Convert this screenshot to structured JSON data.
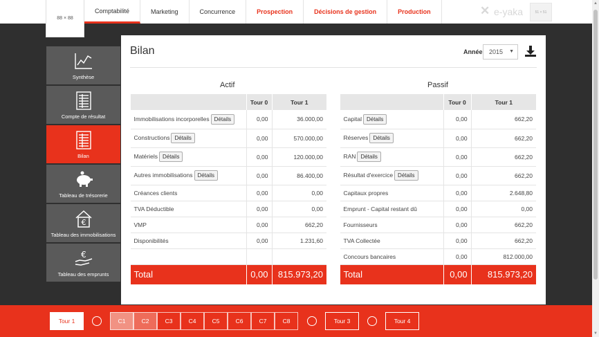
{
  "header": {
    "logo_text": "88 × 88",
    "avatar_text": "51 × 51",
    "brand": "e-yaka",
    "tabs": [
      {
        "label": "Comptabilité"
      },
      {
        "label": "Marketing"
      },
      {
        "label": "Concurrence"
      },
      {
        "label": "Prospection"
      },
      {
        "label": "Décisions de gestion"
      },
      {
        "label": "Production"
      }
    ]
  },
  "sidebar": {
    "items": [
      {
        "label": "Synthèse",
        "icon": "chart-icon"
      },
      {
        "label": "Compte de résultat",
        "icon": "ledger-icon"
      },
      {
        "label": "Bilan",
        "icon": "ledger-icon"
      },
      {
        "label": "Tableau de trésorerie",
        "icon": "piggy-bank-icon"
      },
      {
        "label": "Tableau des immobilisations",
        "icon": "house-euro-icon"
      },
      {
        "label": "Tableau des emprunts",
        "icon": "hand-euro-icon"
      }
    ]
  },
  "main": {
    "title": "Bilan",
    "year_label": "Année",
    "year_value": "2015",
    "details_label": "Détails",
    "actif": {
      "title": "Actif",
      "headers": [
        "",
        "Tour 0",
        "Tour 1"
      ],
      "rows": [
        {
          "label": "Immobilisations incorporelles",
          "details": true,
          "t0": "0,00",
          "t1": "36.000,00"
        },
        {
          "label": "Constructions",
          "details": true,
          "t0": "0,00",
          "t1": "570.000,00"
        },
        {
          "label": "Matériels",
          "details": true,
          "t0": "0,00",
          "t1": "120.000,00"
        },
        {
          "label": "Autres immobilisations",
          "details": true,
          "t0": "0,00",
          "t1": "86.400,00"
        },
        {
          "label": "Créances clients",
          "details": false,
          "t0": "0,00",
          "t1": "0,00"
        },
        {
          "label": "TVA Déductible",
          "details": false,
          "t0": "0,00",
          "t1": "0,00"
        },
        {
          "label": "VMP",
          "details": false,
          "t0": "0,00",
          "t1": "662,20"
        },
        {
          "label": "Disponibilités",
          "details": false,
          "t0": "0,00",
          "t1": "1.231,60"
        },
        {
          "label": "",
          "details": false,
          "t0": "",
          "t1": ""
        }
      ],
      "total": {
        "label": "Total",
        "t0": "0,00",
        "t1": "815.973,20"
      }
    },
    "passif": {
      "title": "Passif",
      "headers": [
        "",
        "Tour 0",
        "Tour 1"
      ],
      "rows": [
        {
          "label": "Capital",
          "details": true,
          "t0": "0,00",
          "t1": "662,20"
        },
        {
          "label": "Réserves",
          "details": true,
          "t0": "0,00",
          "t1": "662,20"
        },
        {
          "label": "RAN",
          "details": true,
          "t0": "0,00",
          "t1": "662,20"
        },
        {
          "label": "Résultat d'exercice",
          "details": true,
          "t0": "0,00",
          "t1": "662,20"
        },
        {
          "label": "Capitaux propres",
          "details": false,
          "t0": "0,00",
          "t1": "2.648,80"
        },
        {
          "label": "Emprunt - Capital restant dû",
          "details": false,
          "t0": "0,00",
          "t1": "0,00"
        },
        {
          "label": "Fournisseurs",
          "details": false,
          "t0": "0,00",
          "t1": "662,20"
        },
        {
          "label": "TVA Collectée",
          "details": false,
          "t0": "0,00",
          "t1": "662,20"
        },
        {
          "label": "Concours bancaires",
          "details": false,
          "t0": "0,00",
          "t1": "812.000,00"
        }
      ],
      "total": {
        "label": "Total",
        "t0": "0,00",
        "t1": "815.973,20"
      }
    }
  },
  "timeline": {
    "tour1": "Tour 1",
    "c_items": [
      "C1",
      "C2",
      "C3",
      "C4",
      "C5",
      "C6",
      "C7",
      "C8"
    ],
    "tour3": "Tour 3",
    "tour4": "Tour 4"
  },
  "colors": {
    "accent": "#e8321c",
    "sidebar": "#5a5a5a",
    "background": "#2f2f2f"
  }
}
